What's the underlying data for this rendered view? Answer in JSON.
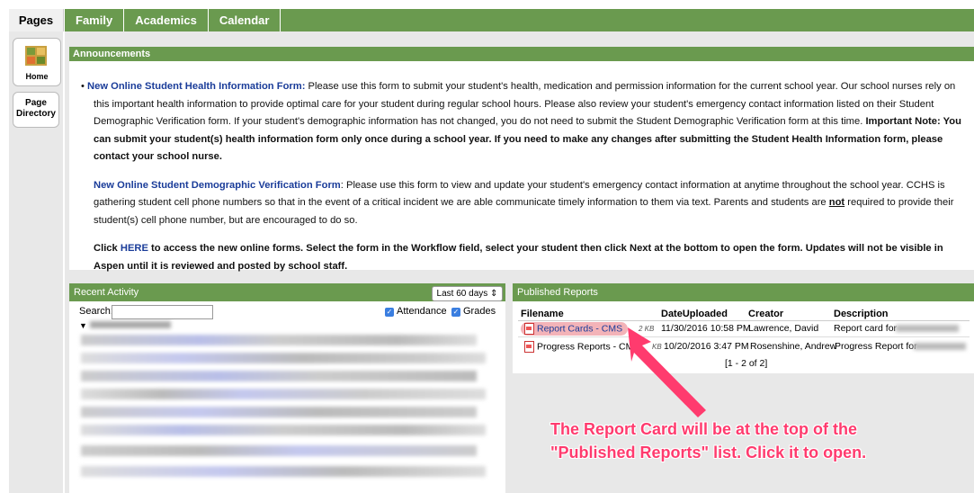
{
  "rail": {
    "header": "Pages",
    "home_label": "Home",
    "directory_label_1": "Page",
    "directory_label_2": "Directory"
  },
  "topnav": {
    "tabs": [
      "Family",
      "Academics",
      "Calendar"
    ]
  },
  "announcements": {
    "title": "Announcements",
    "p1_title": "New Online Student Health Information Form:",
    "p1_text": " Please use this form to submit your student's health, medication and permission information for the current school year. Our school nurses rely on this important health information to provide optimal care for your student during regular school hours. Please also review your student's emergency contact information listed on their Student Demographic Verification form. If your student's demographic information has not changed, you do not need to submit the Student Demographic Verification form at this time. ",
    "p1_bold": "Important Note: You can submit your student(s) health information form only once during a school year. If you need to make any changes after submitting the Student Health Information form, please contact your school nurse.",
    "p2_title": "New Online Student Demographic Verification Form",
    "p2_text_a": ": Please use this form to view and update your student's emergency contact information at anytime throughout the school year. CCHS is gathering student cell phone numbers so that in the event of a critical incident we are able communicate timely information to them via text. Parents and students are ",
    "p2_not": "not",
    "p2_text_b": " required to provide their student(s) cell phone number, but are encouraged to do so.",
    "p3_a": "Click ",
    "p3_here": "HERE",
    "p3_b": " to access the new online forms. Select the form in the Workflow field, select your student then click Next at the bottom to open the form. Updates will not be visible in Aspen until it is reviewed and posted by school staff."
  },
  "recent_activity": {
    "title": "Recent Activity",
    "range": "Last 60 days",
    "search_label": "Search:",
    "search_value": "",
    "attendance_label": "Attendance",
    "grades_label": "Grades"
  },
  "published_reports": {
    "title": "Published Reports",
    "columns": [
      "Filename",
      "DateUploaded",
      "Creator",
      "Description"
    ],
    "rows": [
      {
        "filename": "Report Cards - CMS",
        "size": "2 KB",
        "date": "11/30/2016 10:58 PM",
        "creator": "Lawrence, David",
        "description": "Report card for"
      },
      {
        "filename": "Progress Reports - CM",
        "size": "KB",
        "date": "10/20/2016 3:47 PM",
        "creator": "Rosenshine, Andrew",
        "description": "Progress Report for"
      }
    ],
    "pager": "[1 - 2 of 2]"
  },
  "annotation": {
    "line1": "The Report Card will be at the top of the",
    "line2": "\"Published Reports\" list. Click it to open.",
    "color": "#ff3b6e"
  }
}
